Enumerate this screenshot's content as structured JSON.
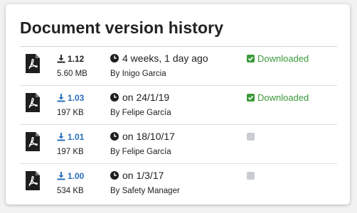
{
  "title": "Document version history",
  "colors": {
    "link": "#2a6ebb",
    "downloaded": "#3a9a3a",
    "pending_box": "#c9cdd3"
  },
  "versions": [
    {
      "version": "1.12",
      "is_link": false,
      "size": "5.60 MB",
      "date": "4 weeks, 1 day ago",
      "by": "By Inigo Garcia",
      "status": "Downloaded",
      "downloaded": true
    },
    {
      "version": "1.03",
      "is_link": true,
      "size": "197 KB",
      "date": "on 24/1/19",
      "by": "By Felipe García",
      "status": "Downloaded",
      "downloaded": true
    },
    {
      "version": "1.01",
      "is_link": true,
      "size": "197 KB",
      "date": "on 18/10/17",
      "by": "By Felipe García",
      "status": "",
      "downloaded": false
    },
    {
      "version": "1.00",
      "is_link": true,
      "size": "534 KB",
      "date": "on 1/3/17",
      "by": "By Safety Manager",
      "status": "",
      "downloaded": false
    }
  ]
}
